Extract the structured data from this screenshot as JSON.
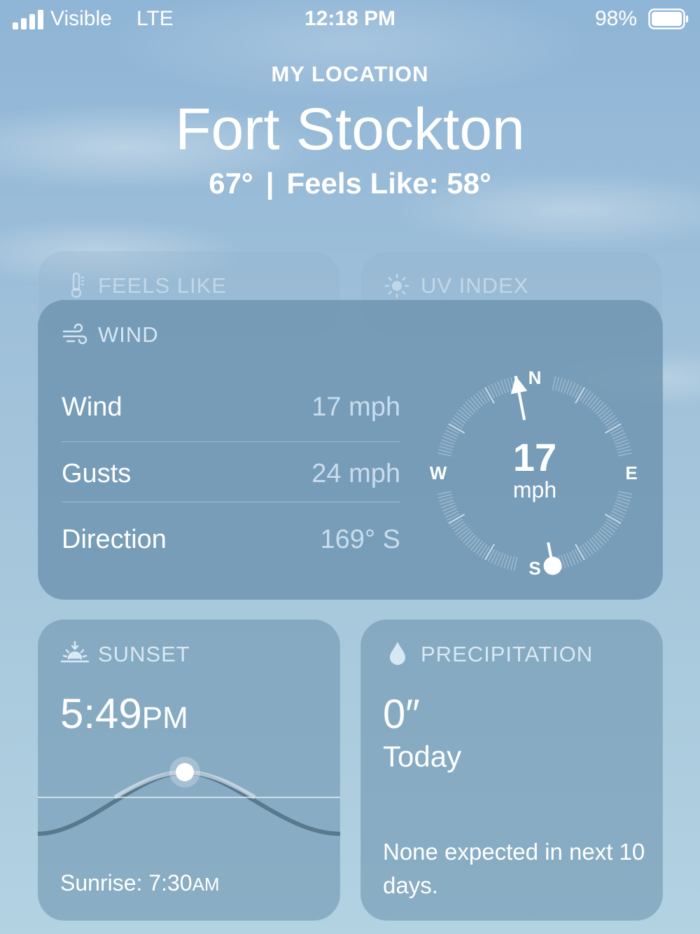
{
  "status_bar": {
    "carrier": "Visible",
    "network": "LTE",
    "time": "12:18 PM",
    "battery_percent": "98%"
  },
  "header": {
    "location_label": "MY LOCATION",
    "city": "Fort Stockton",
    "temperature": "67°",
    "separator": "|",
    "feels_like": "Feels Like: 58°"
  },
  "cards": {
    "feels_like": {
      "title": "FEELS LIKE",
      "icon": "thermometer-icon"
    },
    "uv_index": {
      "title": "UV INDEX",
      "icon": "sun-icon"
    },
    "wind": {
      "title": "WIND",
      "icon": "wind-icon",
      "rows": [
        {
          "label": "Wind",
          "value": "17 mph"
        },
        {
          "label": "Gusts",
          "value": "24 mph"
        },
        {
          "label": "Direction",
          "value": "169° S"
        }
      ],
      "compass": {
        "speed": "17",
        "unit": "mph",
        "north": "N",
        "east": "E",
        "south": "S",
        "west": "W",
        "direction_degrees": 169
      }
    },
    "sunset": {
      "title": "SUNSET",
      "icon": "sunset-icon",
      "time": "5:49",
      "time_suffix": "PM",
      "sunrise_label": "Sunrise: 7:30",
      "sunrise_suffix": "AM"
    },
    "precipitation": {
      "title": "PRECIPITATION",
      "icon": "raindrop-icon",
      "amount": "0″",
      "period": "Today",
      "note": "None expected in next 10 days."
    }
  },
  "colors": {
    "sky_top": "#8fb5d6",
    "sky_bottom": "#b3d2e2",
    "card": "#6890ac"
  }
}
